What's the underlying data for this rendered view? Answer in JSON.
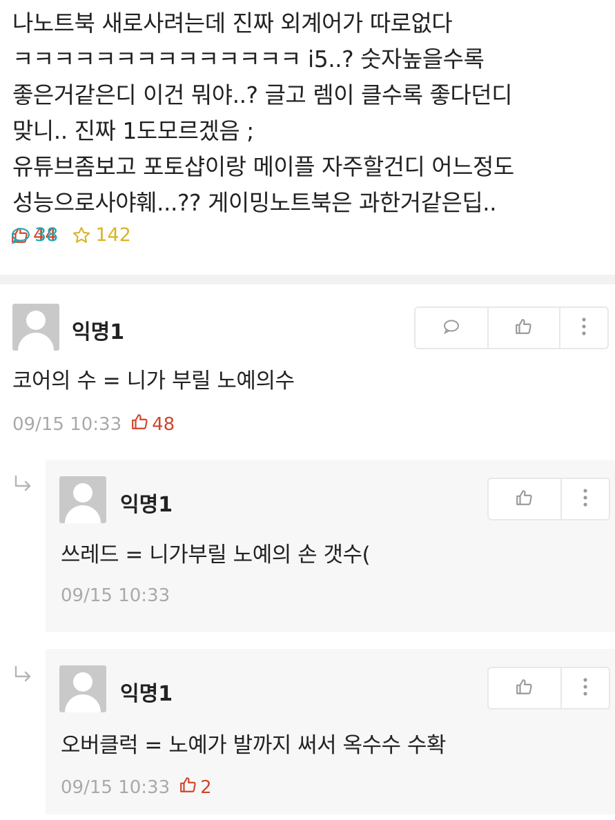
{
  "post": {
    "lines": [
      "나노트북 새로사려는데 진짜 외계어가 따로없다",
      "ㅋㅋㅋㅋㅋㅋㅋㅋㅋㅋㅋㅋㅋㅋ i5..? 숫자높을수록",
      "좋은거같은디 이건 뭐야..? 글고 렘이 클수록 좋다던디",
      "맞니.. 진짜 1도모르겠음 ;",
      "유튜브좀보고 포토샵이랑 메이플 자주할건디 어느정도",
      "성능으로사야훼...?? 게이밍노트북은 과한거같은딥.."
    ],
    "likes": "44",
    "comments": "38",
    "scraps": "142",
    "colors": {
      "like": "#d2452b",
      "comment": "#22a6b3",
      "scrap": "#d9b425"
    }
  },
  "comments": [
    {
      "author": "익명1",
      "text": "코어의 수 = 니가 부릴 노예의수",
      "time": "09/15 10:33",
      "likes": "48"
    }
  ],
  "replies": [
    {
      "author": "익명1",
      "text": "쓰레드 = 니가부릴 노예의 손 갯수(",
      "time": "09/15 10:33",
      "likes": ""
    },
    {
      "author": "익명1",
      "text": "오버클럭 = 노예가 발까지 써서 옥수수 수확",
      "time": "09/15 10:33",
      "likes": "2"
    }
  ],
  "icons": {
    "like": "thumbs-up-icon",
    "comment": "speech-bubble-icon",
    "scrap": "star-icon",
    "more": "vertical-ellipsis-icon",
    "reply": "reply-arrow-icon"
  }
}
